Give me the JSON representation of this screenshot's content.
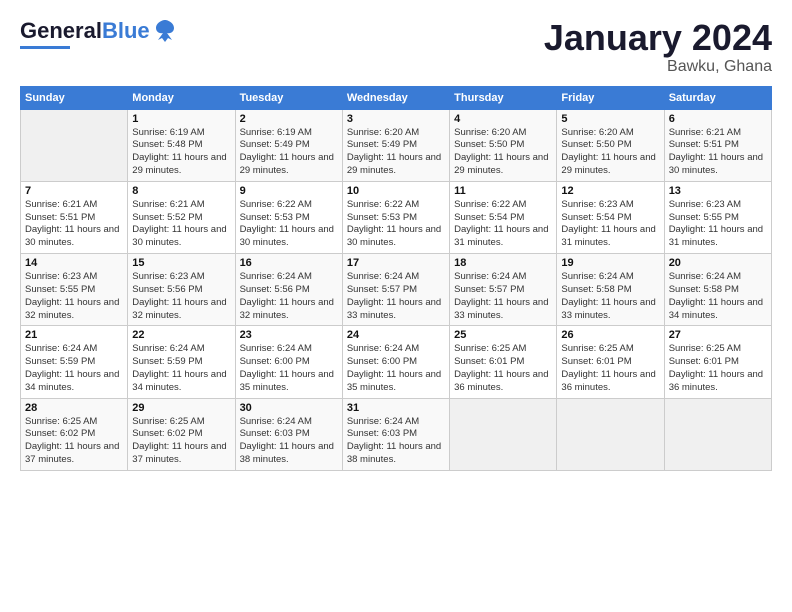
{
  "logo": {
    "text_general": "General",
    "text_blue": "Blue"
  },
  "title": "January 2024",
  "subtitle": "Bawku, Ghana",
  "header_days": [
    "Sunday",
    "Monday",
    "Tuesday",
    "Wednesday",
    "Thursday",
    "Friday",
    "Saturday"
  ],
  "weeks": [
    [
      {
        "day": "",
        "sunrise": "",
        "sunset": "",
        "daylight": ""
      },
      {
        "day": "1",
        "sunrise": "Sunrise: 6:19 AM",
        "sunset": "Sunset: 5:48 PM",
        "daylight": "Daylight: 11 hours and 29 minutes."
      },
      {
        "day": "2",
        "sunrise": "Sunrise: 6:19 AM",
        "sunset": "Sunset: 5:49 PM",
        "daylight": "Daylight: 11 hours and 29 minutes."
      },
      {
        "day": "3",
        "sunrise": "Sunrise: 6:20 AM",
        "sunset": "Sunset: 5:49 PM",
        "daylight": "Daylight: 11 hours and 29 minutes."
      },
      {
        "day": "4",
        "sunrise": "Sunrise: 6:20 AM",
        "sunset": "Sunset: 5:50 PM",
        "daylight": "Daylight: 11 hours and 29 minutes."
      },
      {
        "day": "5",
        "sunrise": "Sunrise: 6:20 AM",
        "sunset": "Sunset: 5:50 PM",
        "daylight": "Daylight: 11 hours and 29 minutes."
      },
      {
        "day": "6",
        "sunrise": "Sunrise: 6:21 AM",
        "sunset": "Sunset: 5:51 PM",
        "daylight": "Daylight: 11 hours and 30 minutes."
      }
    ],
    [
      {
        "day": "7",
        "sunrise": "Sunrise: 6:21 AM",
        "sunset": "Sunset: 5:51 PM",
        "daylight": "Daylight: 11 hours and 30 minutes."
      },
      {
        "day": "8",
        "sunrise": "Sunrise: 6:21 AM",
        "sunset": "Sunset: 5:52 PM",
        "daylight": "Daylight: 11 hours and 30 minutes."
      },
      {
        "day": "9",
        "sunrise": "Sunrise: 6:22 AM",
        "sunset": "Sunset: 5:53 PM",
        "daylight": "Daylight: 11 hours and 30 minutes."
      },
      {
        "day": "10",
        "sunrise": "Sunrise: 6:22 AM",
        "sunset": "Sunset: 5:53 PM",
        "daylight": "Daylight: 11 hours and 30 minutes."
      },
      {
        "day": "11",
        "sunrise": "Sunrise: 6:22 AM",
        "sunset": "Sunset: 5:54 PM",
        "daylight": "Daylight: 11 hours and 31 minutes."
      },
      {
        "day": "12",
        "sunrise": "Sunrise: 6:23 AM",
        "sunset": "Sunset: 5:54 PM",
        "daylight": "Daylight: 11 hours and 31 minutes."
      },
      {
        "day": "13",
        "sunrise": "Sunrise: 6:23 AM",
        "sunset": "Sunset: 5:55 PM",
        "daylight": "Daylight: 11 hours and 31 minutes."
      }
    ],
    [
      {
        "day": "14",
        "sunrise": "Sunrise: 6:23 AM",
        "sunset": "Sunset: 5:55 PM",
        "daylight": "Daylight: 11 hours and 32 minutes."
      },
      {
        "day": "15",
        "sunrise": "Sunrise: 6:23 AM",
        "sunset": "Sunset: 5:56 PM",
        "daylight": "Daylight: 11 hours and 32 minutes."
      },
      {
        "day": "16",
        "sunrise": "Sunrise: 6:24 AM",
        "sunset": "Sunset: 5:56 PM",
        "daylight": "Daylight: 11 hours and 32 minutes."
      },
      {
        "day": "17",
        "sunrise": "Sunrise: 6:24 AM",
        "sunset": "Sunset: 5:57 PM",
        "daylight": "Daylight: 11 hours and 33 minutes."
      },
      {
        "day": "18",
        "sunrise": "Sunrise: 6:24 AM",
        "sunset": "Sunset: 5:57 PM",
        "daylight": "Daylight: 11 hours and 33 minutes."
      },
      {
        "day": "19",
        "sunrise": "Sunrise: 6:24 AM",
        "sunset": "Sunset: 5:58 PM",
        "daylight": "Daylight: 11 hours and 33 minutes."
      },
      {
        "day": "20",
        "sunrise": "Sunrise: 6:24 AM",
        "sunset": "Sunset: 5:58 PM",
        "daylight": "Daylight: 11 hours and 34 minutes."
      }
    ],
    [
      {
        "day": "21",
        "sunrise": "Sunrise: 6:24 AM",
        "sunset": "Sunset: 5:59 PM",
        "daylight": "Daylight: 11 hours and 34 minutes."
      },
      {
        "day": "22",
        "sunrise": "Sunrise: 6:24 AM",
        "sunset": "Sunset: 5:59 PM",
        "daylight": "Daylight: 11 hours and 34 minutes."
      },
      {
        "day": "23",
        "sunrise": "Sunrise: 6:24 AM",
        "sunset": "Sunset: 6:00 PM",
        "daylight": "Daylight: 11 hours and 35 minutes."
      },
      {
        "day": "24",
        "sunrise": "Sunrise: 6:24 AM",
        "sunset": "Sunset: 6:00 PM",
        "daylight": "Daylight: 11 hours and 35 minutes."
      },
      {
        "day": "25",
        "sunrise": "Sunrise: 6:25 AM",
        "sunset": "Sunset: 6:01 PM",
        "daylight": "Daylight: 11 hours and 36 minutes."
      },
      {
        "day": "26",
        "sunrise": "Sunrise: 6:25 AM",
        "sunset": "Sunset: 6:01 PM",
        "daylight": "Daylight: 11 hours and 36 minutes."
      },
      {
        "day": "27",
        "sunrise": "Sunrise: 6:25 AM",
        "sunset": "Sunset: 6:01 PM",
        "daylight": "Daylight: 11 hours and 36 minutes."
      }
    ],
    [
      {
        "day": "28",
        "sunrise": "Sunrise: 6:25 AM",
        "sunset": "Sunset: 6:02 PM",
        "daylight": "Daylight: 11 hours and 37 minutes."
      },
      {
        "day": "29",
        "sunrise": "Sunrise: 6:25 AM",
        "sunset": "Sunset: 6:02 PM",
        "daylight": "Daylight: 11 hours and 37 minutes."
      },
      {
        "day": "30",
        "sunrise": "Sunrise: 6:24 AM",
        "sunset": "Sunset: 6:03 PM",
        "daylight": "Daylight: 11 hours and 38 minutes."
      },
      {
        "day": "31",
        "sunrise": "Sunrise: 6:24 AM",
        "sunset": "Sunset: 6:03 PM",
        "daylight": "Daylight: 11 hours and 38 minutes."
      },
      {
        "day": "",
        "sunrise": "",
        "sunset": "",
        "daylight": ""
      },
      {
        "day": "",
        "sunrise": "",
        "sunset": "",
        "daylight": ""
      },
      {
        "day": "",
        "sunrise": "",
        "sunset": "",
        "daylight": ""
      }
    ]
  ]
}
